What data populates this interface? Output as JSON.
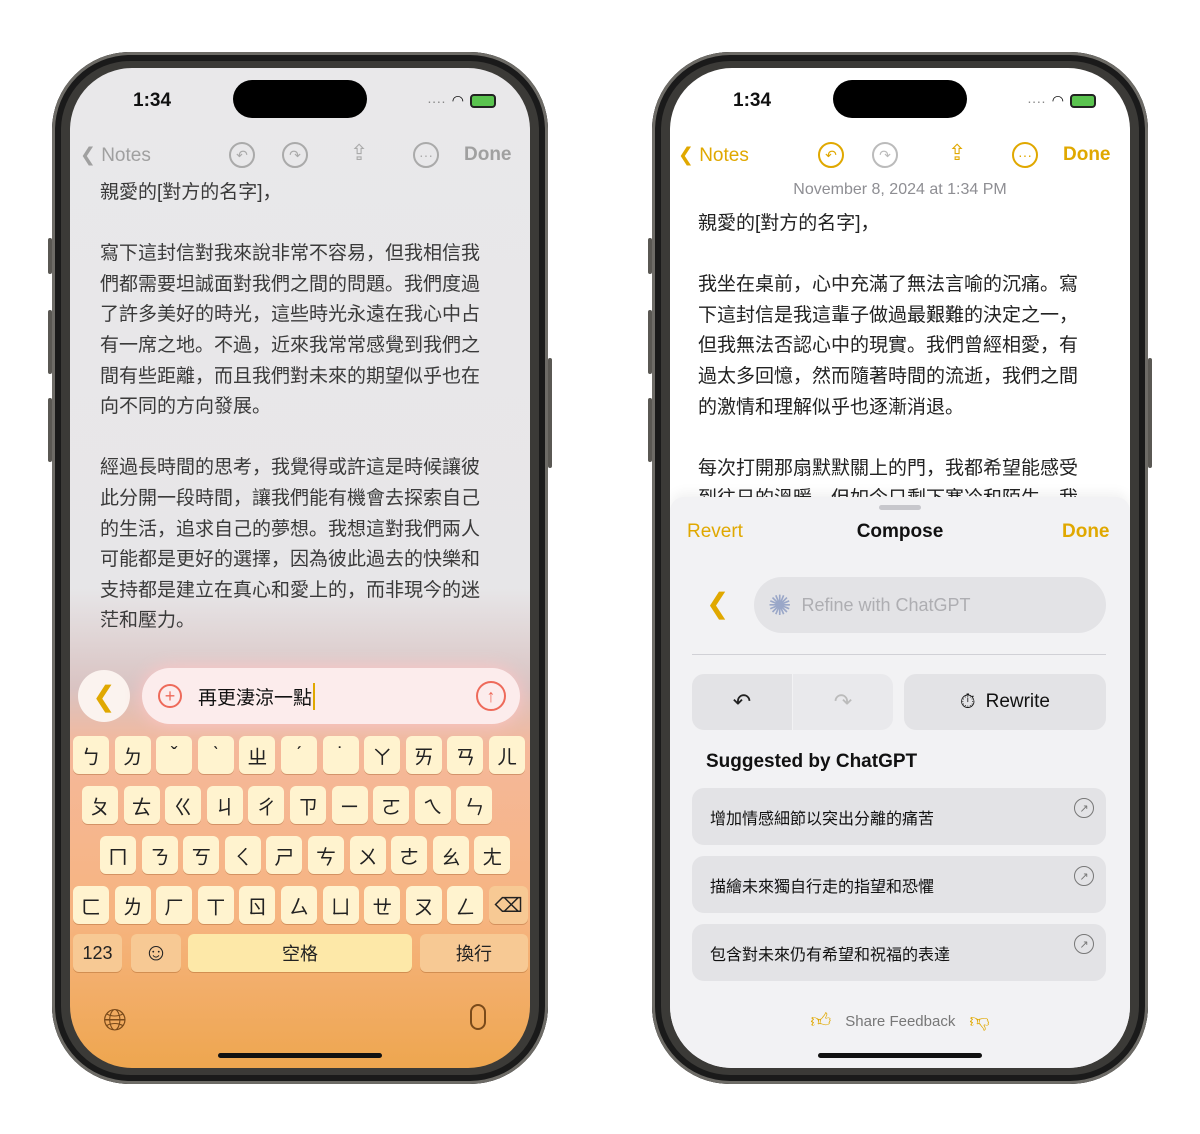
{
  "status": {
    "time": "1:34"
  },
  "left": {
    "nav": {
      "back": "Notes",
      "done": "Done"
    },
    "note_lines": [
      "親愛的[對方的名字]，",
      "",
      "寫下這封信對我來說非常不容易，但我相信我",
      "們都需要坦誠面對我們之間的問題。我們度過",
      "了許多美好的時光，這些時光永遠在我心中占",
      "有一席之地。不過，近來我常常感覺到我們之",
      "間有些距離，而且我們對未來的期望似乎也在",
      "向不同的方向發展。",
      "",
      "經過長時間的思考，我覺得或許這是時候讓彼",
      "此分開一段時間，讓我們能有機會去探索自己",
      "的生活，追求自己的夢想。我想這對我們兩人",
      "可能都是更好的選擇，因為彼此過去的快樂和",
      "支持都是建立在真心和愛上的，而非現今的迷",
      "茫和壓力。"
    ],
    "input_value": "再更淒涼一點",
    "keyboard": {
      "rows": [
        [
          "ㄅ",
          "ㄉ",
          "ˇ",
          "ˋ",
          "ㄓ",
          "ˊ",
          "˙",
          "ㄚ",
          "ㄞ",
          "ㄢ",
          "ㄦ"
        ],
        [
          "ㄆ",
          "ㄊ",
          "ㄍ",
          "ㄐ",
          "ㄔ",
          "ㄗ",
          "ㄧ",
          "ㄛ",
          "ㄟ",
          "ㄣ"
        ],
        [
          "ㄇ",
          "ㄋ",
          "ㄎ",
          "ㄑ",
          "ㄕ",
          "ㄘ",
          "ㄨ",
          "ㄜ",
          "ㄠ",
          "ㄤ"
        ],
        [
          "ㄈ",
          "ㄌ",
          "ㄏ",
          "ㄒ",
          "ㄖ",
          "ㄙ",
          "ㄩ",
          "ㄝ",
          "ㄡ",
          "ㄥ"
        ]
      ],
      "numbers": "123",
      "space": "空格",
      "return": "換行"
    }
  },
  "right": {
    "nav": {
      "back": "Notes",
      "done": "Done"
    },
    "date": "November 8, 2024 at 1:34 PM",
    "note_lines": [
      "親愛的[對方的名字]，",
      "",
      "我坐在桌前，心中充滿了無法言喻的沉痛。寫",
      "下這封信是我這輩子做過最艱難的決定之一，",
      "但我無法否認心中的現實。我們曾經相愛，有",
      "過太多回憶，然而隨著時間的流逝，我們之間",
      "的激情和理解似乎也逐漸消退。",
      "",
      "每次打開那扇默默關上的門，我都希望能感受",
      "到往日的溫暖，但如今只剩下寒冷和陌生。我"
    ],
    "sheet": {
      "revert": "Revert",
      "title": "Compose",
      "done": "Done",
      "placeholder": "Refine with ChatGPT",
      "rewrite": "Rewrite",
      "suggested_title": "Suggested by ChatGPT",
      "suggestions": [
        "增加情感細節以突出分離的痛苦",
        "描繪未來獨自行走的指望和恐懼",
        "包含對未來仍有希望和祝福的表達"
      ],
      "feedback": "Share Feedback"
    }
  },
  "colors": {
    "accent": "#e0a800",
    "sheet_bg": "#f2f2f4"
  }
}
